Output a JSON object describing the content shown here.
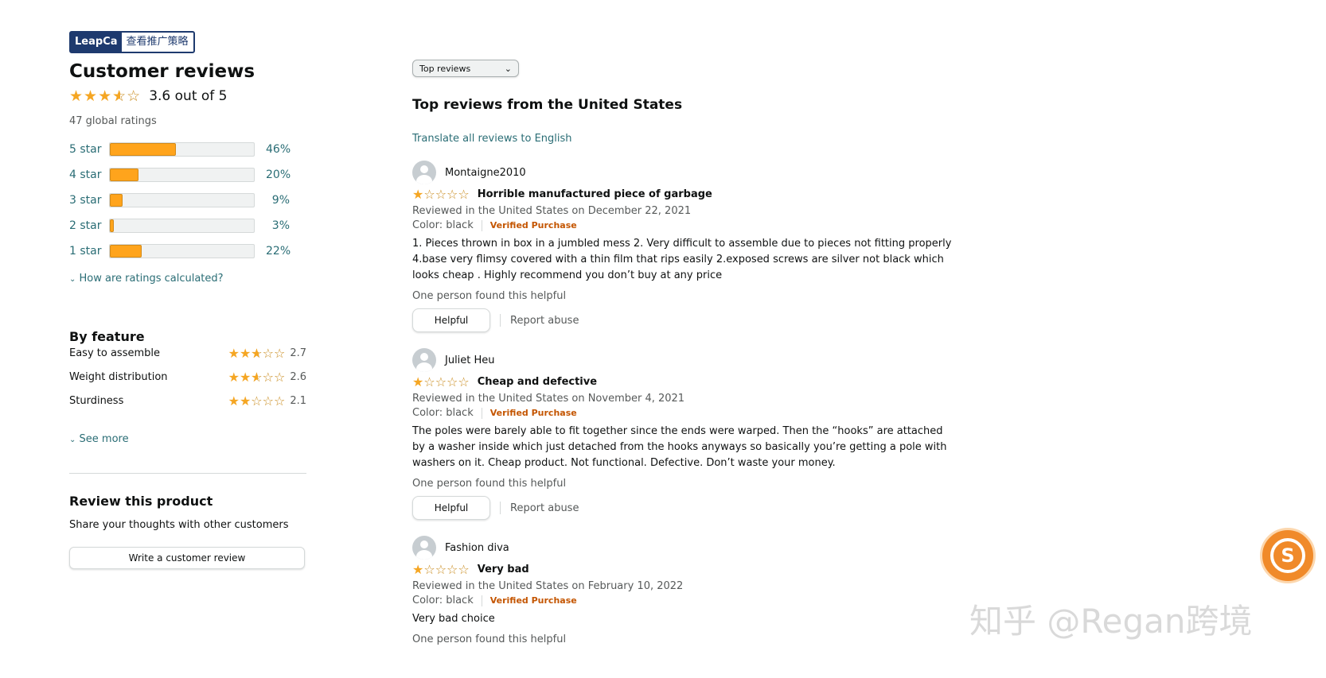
{
  "badge": {
    "brand": "LeapCa",
    "link": "查看推广策略"
  },
  "summary": {
    "title": "Customer reviews",
    "rating_value": 3.6,
    "rating_text": "3.6 out of 5",
    "global": "47 global ratings",
    "histogram": [
      {
        "label": "5 star",
        "pct": "46%",
        "value": 46
      },
      {
        "label": "4 star",
        "pct": "20%",
        "value": 20
      },
      {
        "label": "3 star",
        "pct": "9%",
        "value": 9
      },
      {
        "label": "2 star",
        "pct": "3%",
        "value": 3
      },
      {
        "label": "1 star",
        "pct": "22%",
        "value": 22
      }
    ],
    "how_link": "How are ratings calculated?"
  },
  "by_feature": {
    "title": "By feature",
    "items": [
      {
        "name": "Easy to assemble",
        "rating": "2.7",
        "value": 2.7
      },
      {
        "name": "Weight distribution",
        "rating": "2.6",
        "value": 2.6
      },
      {
        "name": "Sturdiness",
        "rating": "2.1",
        "value": 2.1
      }
    ],
    "see_more": "See more"
  },
  "review_product": {
    "title": "Review this product",
    "subtitle": "Share your thoughts with other customers",
    "button": "Write a customer review"
  },
  "sort": {
    "selected": "Top reviews"
  },
  "reviews_section": {
    "title": "Top reviews from the United States",
    "translate": "Translate all reviews to English"
  },
  "reviews": [
    {
      "author": "Montaigne2010",
      "stars": 1,
      "title": "Horrible manufactured piece of garbage",
      "date": "Reviewed in the United States on December 22, 2021",
      "color": "Color: black",
      "verified": "Verified Purchase",
      "body": "1. Pieces thrown in box in a jumbled mess 2. Very difficult to assemble due to pieces not fitting properly 4.base very flimsy covered with a thin film that rips easily 2.exposed screws are silver not black which looks cheap . Highly recommend you don’t buy at any price",
      "helpful_text": "One person found this helpful",
      "helpful_btn": "Helpful",
      "report": "Report abuse"
    },
    {
      "author": "Juliet Heu",
      "stars": 1,
      "title": "Cheap and defective",
      "date": "Reviewed in the United States on November 4, 2021",
      "color": "Color: black",
      "verified": "Verified Purchase",
      "body": "The poles were barely able to fit together since the ends were warped. Then the “hooks” are attached by a washer inside which just detached from the hooks anyways so basically you’re getting a pole with washers on it. Cheap product. Not functional. Defective. Don’t waste your money.",
      "helpful_text": "One person found this helpful",
      "helpful_btn": "Helpful",
      "report": "Report abuse"
    },
    {
      "author": "Fashion diva",
      "stars": 1,
      "title": "Very bad",
      "date": "Reviewed in the United States on February 10, 2022",
      "color": "Color: black",
      "verified": "Verified Purchase",
      "body": "Very bad choice",
      "helpful_text": "One person found this helpful"
    }
  ],
  "watermark": "知乎 @Regan跨境",
  "colors": {
    "star": "#f5a623",
    "bar_fill": "#ffa41c",
    "link": "#2a6d75",
    "verified": "#c45500",
    "badge": "#1e3a6e"
  },
  "icons": {
    "avatar": "user-avatar-icon",
    "sort_arrow": "chevron-down-icon",
    "floating": "zhihu-s-logo"
  }
}
